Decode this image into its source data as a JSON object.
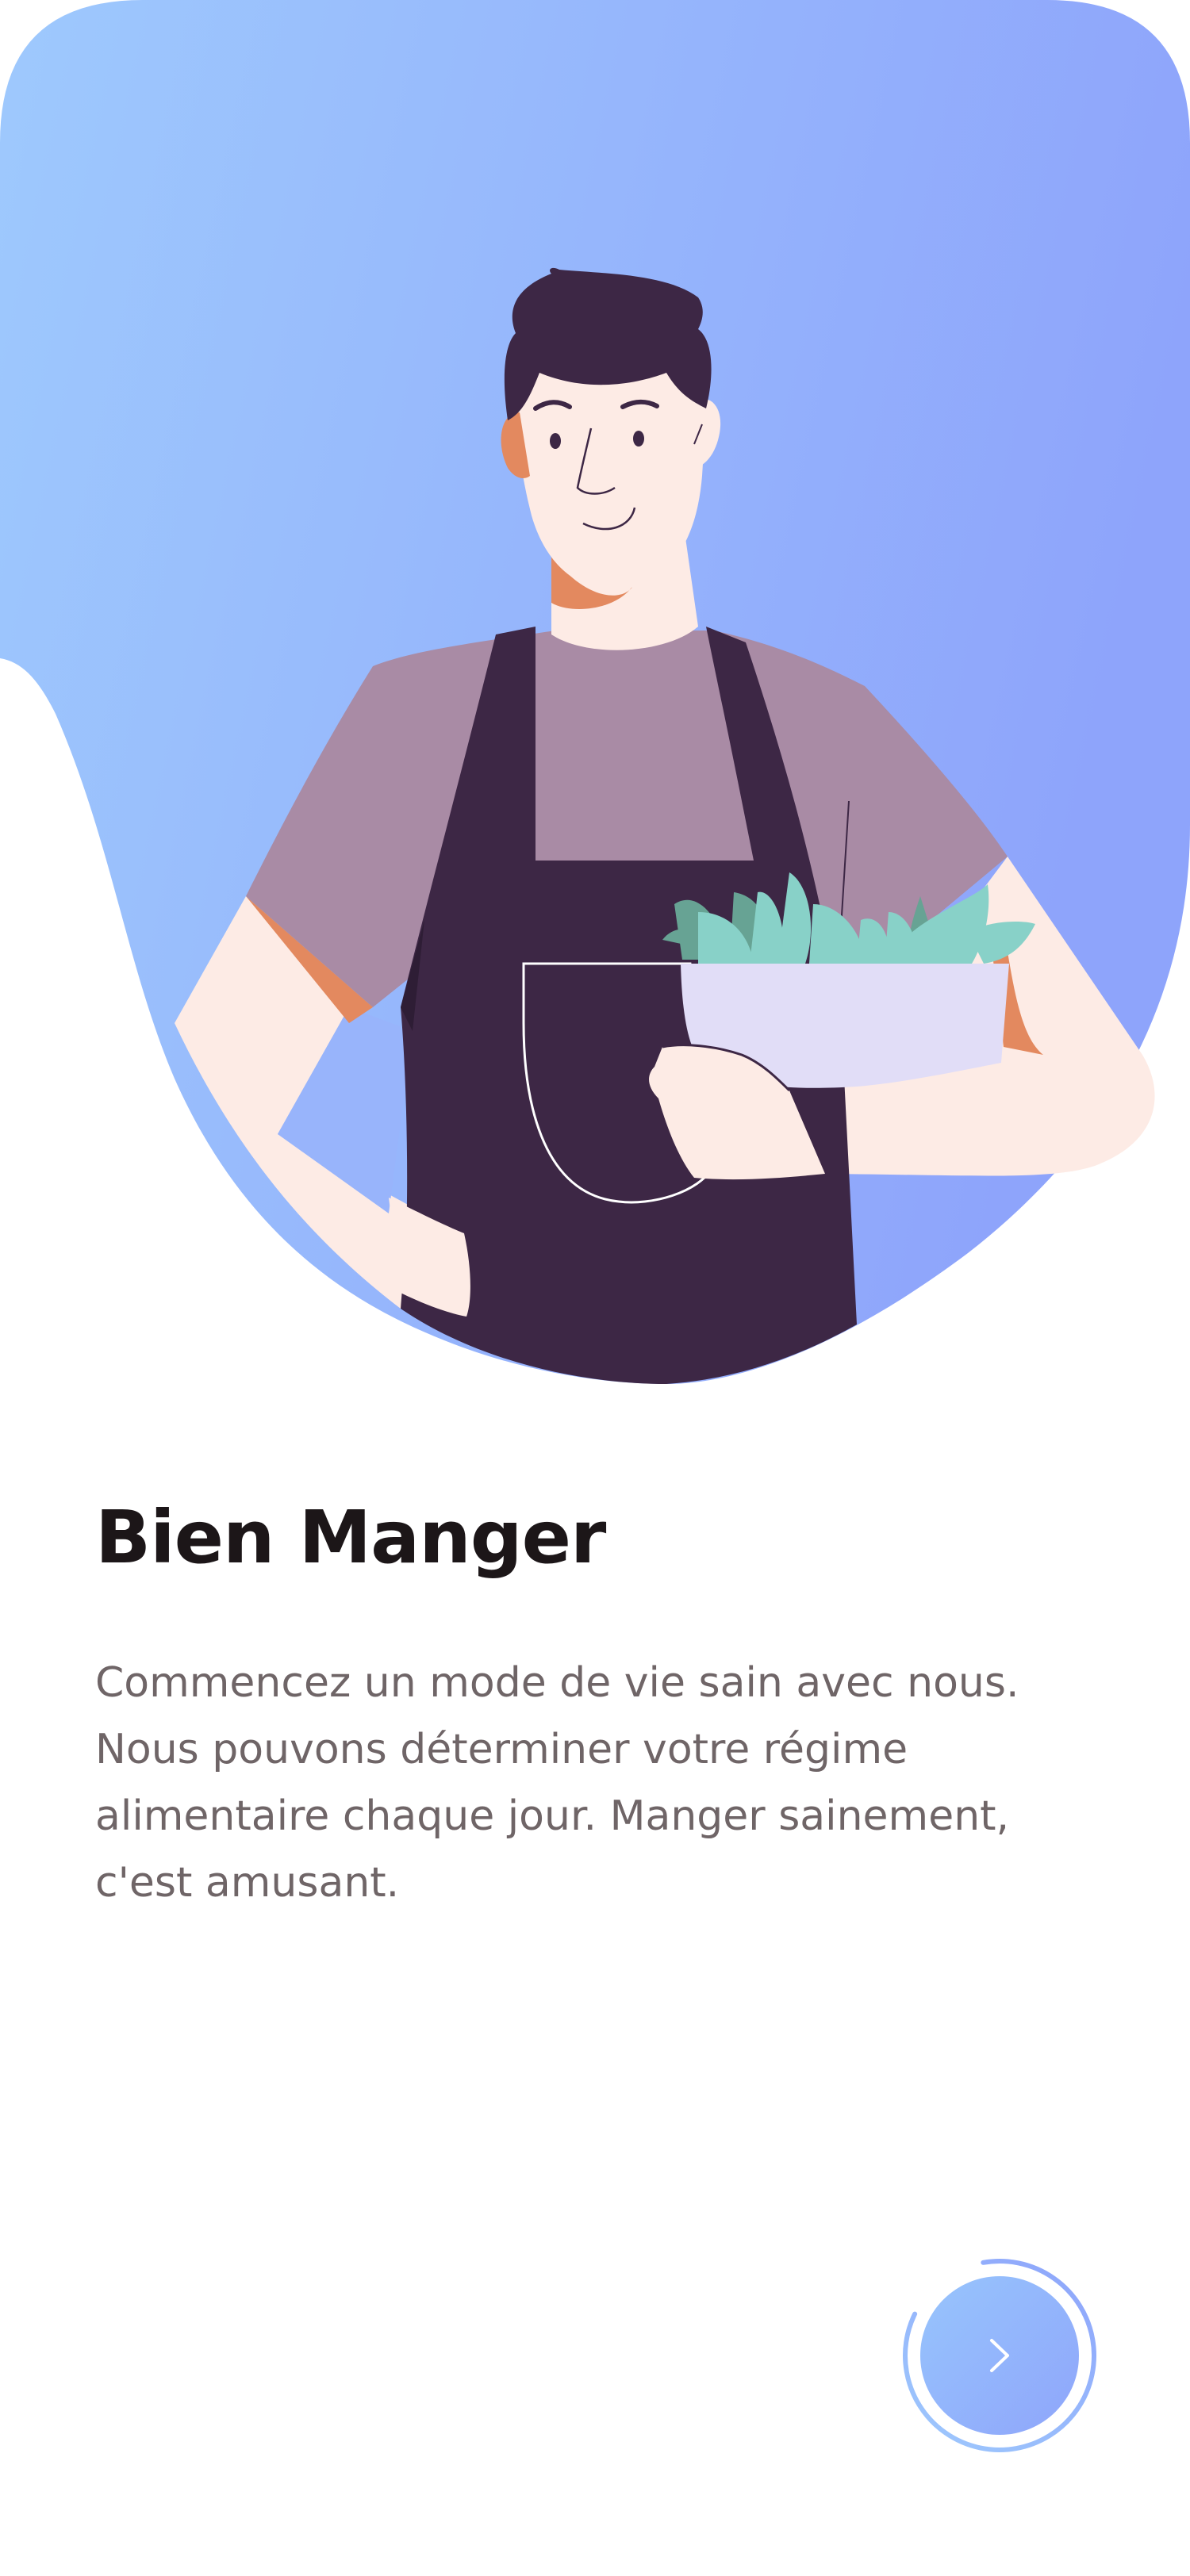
{
  "onboarding": {
    "title": "Bien Manger",
    "description": "Commencez un mode de vie sain avec nous.\nNous pouvons déterminer votre régime\nalimentaire chaque jour. Manger sainement,\nc'est amusant.",
    "progress": 0.85
  },
  "colors": {
    "gradient_start": "#9ec9fd",
    "gradient_end": "#8ea4fb",
    "apron": "#3d2745",
    "shirt": "#a98ba5",
    "skin": "#fdebe5",
    "title_text": "#1c1618",
    "body_text": "#6f6567"
  },
  "icons": {
    "next": "chevron-right-icon"
  }
}
